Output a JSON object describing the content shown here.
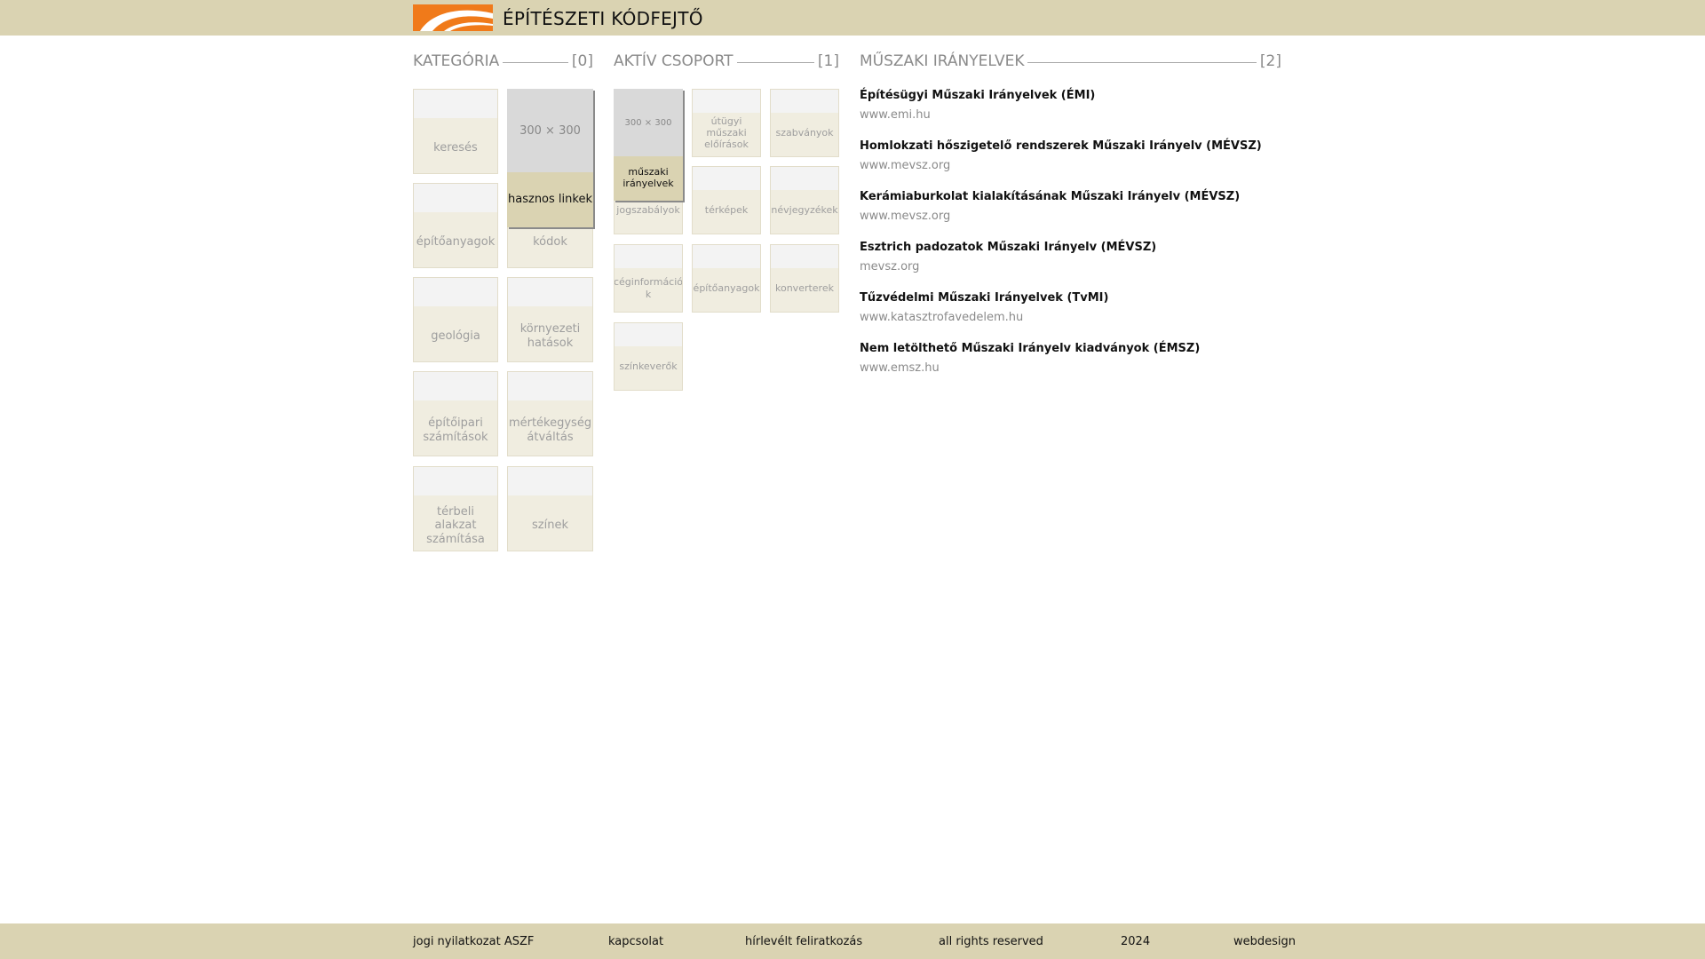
{
  "header": {
    "title": "ÉPÍTÉSZETI KÓDFEJTŐ",
    "logo_colors": [
      "#f07a1a",
      "#ffffff"
    ]
  },
  "sections": {
    "category": {
      "title": "KATEGÓRIA",
      "count": "[0]"
    },
    "group": {
      "title": "AKTÍV CSOPORT",
      "count": "[1]"
    },
    "guidelines": {
      "title": "MŰSZAKI IRÁNYELVEK",
      "count": "[2]"
    }
  },
  "categories": [
    "keresés",
    "kódok",
    "építőanyagok",
    "geológia",
    "környezeti hatások",
    "építőipari számítások",
    "mértékegység átváltás",
    "térbeli alakzat számítása",
    "színek"
  ],
  "category_hover": {
    "placeholder": "300 × 300",
    "label": "hasznos linkek"
  },
  "groups": [
    "útügyi műszaki előírások",
    "szabványok",
    "jogszabályok",
    "térképek",
    "névjegyzékek",
    "céginformáció k",
    "építőanyagok",
    "konverterek",
    "színkeverők"
  ],
  "group_hover": {
    "placeholder": "300 × 300",
    "label": "műszaki irányelvek"
  },
  "links": [
    {
      "title": "Építésügyi Műszaki Irányelvek (ÉMI)",
      "url": "www.emi.hu"
    },
    {
      "title": "Homlokzati hőszigetelő rendszerek Műszaki Irányelv (MÉVSZ)",
      "url": "www.mevsz.org"
    },
    {
      "title": "Kerámiaburkolat kialakításának Műszaki Irányelv (MÉVSZ)",
      "url": "www.mevsz.org"
    },
    {
      "title": "Esztrich padozatok Műszaki Irányelv (MÉVSZ)",
      "url": "mevsz.org"
    },
    {
      "title": "Tűzvédelmi Műszaki Irányelvek (TvMI)",
      "url": "www.katasztrofavedelem.hu"
    },
    {
      "title": "Nem letölthető Műszaki Irányelv kiadványok (ÉMSZ)",
      "url": "www.emsz.hu"
    }
  ],
  "footer": {
    "legal": "jogi nyilatkozat ASZF",
    "contact": "kapcsolat",
    "newsletter": "hírlevélt feliratkozás",
    "rights": "all rights reserved",
    "year": "2024",
    "webdesign": "webdesign"
  }
}
